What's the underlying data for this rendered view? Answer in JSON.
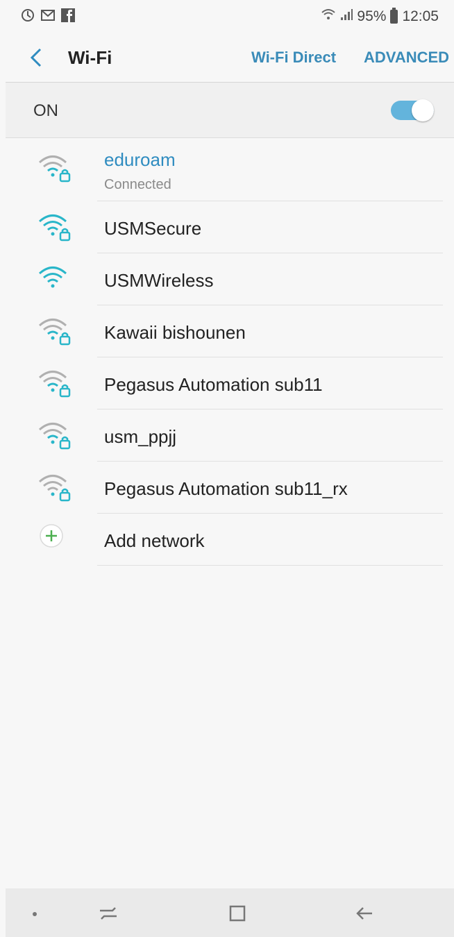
{
  "status_bar": {
    "left_icons": [
      "do-not-disturb-icon",
      "gmail-icon",
      "facebook-icon"
    ],
    "battery_percent": "95%",
    "time": "12:05",
    "right_icons": [
      "wifi-status-icon",
      "signal-icon",
      "battery-icon"
    ]
  },
  "app_bar": {
    "title": "Wi-Fi",
    "wifi_direct_label": "Wi-Fi Direct",
    "advanced_label": "ADVANCED"
  },
  "wifi_toggle": {
    "label": "ON",
    "enabled": true
  },
  "networks": [
    {
      "name": "eduroam",
      "status": "Connected",
      "secured": true,
      "strength": "strong",
      "connected": true
    },
    {
      "name": "USMSecure",
      "secured": true,
      "strength": "strong"
    },
    {
      "name": "USMWireless",
      "secured": false,
      "strength": "strong"
    },
    {
      "name": "Kawaii bishounen",
      "secured": true,
      "strength": "weak"
    },
    {
      "name": "Pegasus Automation sub11",
      "secured": true,
      "strength": "weak"
    },
    {
      "name": "usm_ppjj",
      "secured": true,
      "strength": "weak"
    },
    {
      "name": "Pegasus Automation sub11_rx",
      "secured": true,
      "strength": "weak"
    }
  ],
  "add_network": {
    "label": "Add network"
  },
  "colors": {
    "accent": "#2f8cc0",
    "toggle_on": "#63b4dc",
    "add_icon": "#4caf50",
    "icon_strong": "#29b6c9",
    "icon_weak": "#b0b0b0"
  }
}
